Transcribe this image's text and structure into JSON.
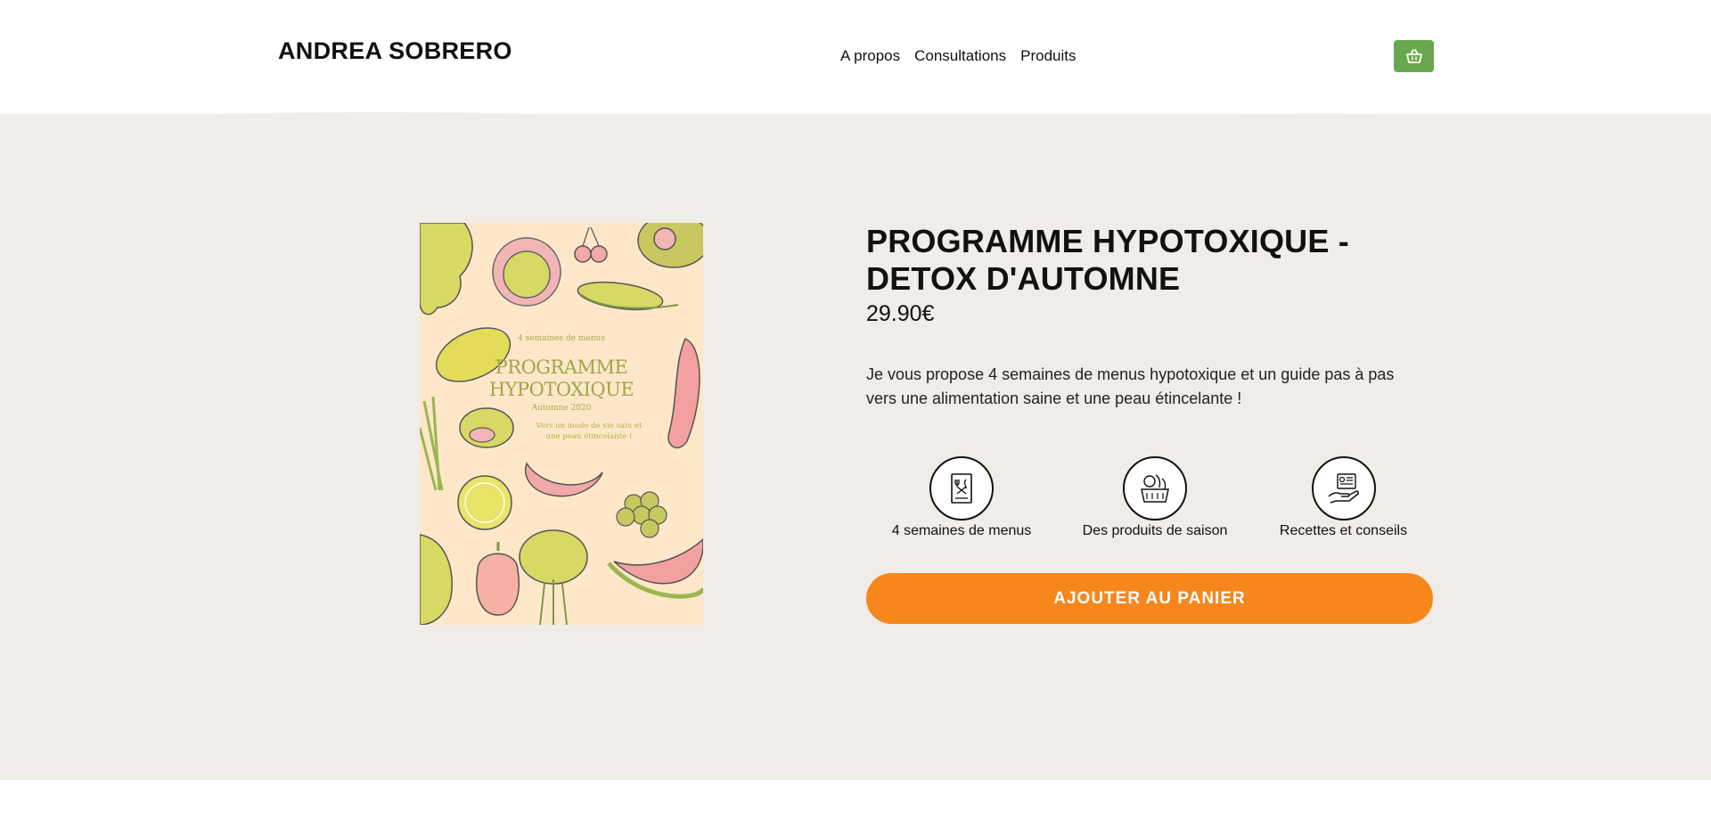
{
  "header": {
    "logo": "ANDREA SOBRERO",
    "nav": [
      "A propos",
      "Consultations",
      "Produits"
    ],
    "cart_icon": "basket-icon",
    "cart_color": "#6aa84f"
  },
  "product": {
    "title": "PROGRAMME HYPOTOXIQUE - DETOX D'AUTOMNE",
    "price": "29.90€",
    "description": "Je vous propose 4 semaines de menus hypotoxique et un guide pas à pas vers une alimentation saine et une peau étincelante !",
    "features": [
      {
        "label": "4 semaines de menus",
        "icon": "menu-card-icon"
      },
      {
        "label": "Des produits de saison",
        "icon": "vegetables-basket-icon"
      },
      {
        "label": "Recettes et conseils",
        "icon": "hand-recipe-icon"
      }
    ],
    "add_to_cart": "AJOUTER AU PANIER",
    "button_color": "#f7861c",
    "hero_bg": "#f0ece7"
  },
  "cover": {
    "subtitle": "4 semaines de menus",
    "title_line1": "PROGRAMME",
    "title_line2": "HYPOTOXIQUE",
    "season": "Automne 2020",
    "tagline": "Vers un mode de vie sain et une peau étincelante !"
  }
}
